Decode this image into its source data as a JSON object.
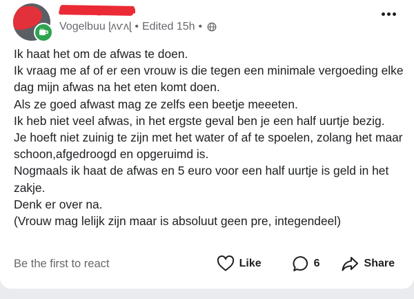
{
  "post": {
    "author_meta": "Vogelbuu ɭʌѵʌɭ • Edited 15h •",
    "author_group": "Vogelbuu ɭʌѵʌɭ",
    "edited_label": "Edited 15h",
    "lines": [
      "Ik haat het om de afwas te doen.",
      "Ik vraag me af of er een vrouw is die tegen een minimale vergoeding elke dag mijn afwas na het eten komt doen.",
      "Als ze goed afwast mag ze zelfs een beetje meeeten.",
      "Ik heb niet veel afwas, in het ergste geval ben je een half uurtje bezig.",
      "Je hoeft niet zuinig te zijn met het water of af te spoelen, zolang het maar schoon,afgedroogd en opgeruimd is.",
      "Nogmaals ik haat de afwas en 5 euro voor een half uurtje is geld in het zakje.",
      "Denk er over na.",
      "(Vrouw mag lelijk zijn maar is absoluut geen pre, integendeel)"
    ]
  },
  "footer": {
    "react_prompt": "Be the first to react",
    "like_label": "Like",
    "comment_count": "6",
    "share_label": "Share"
  },
  "icons": {
    "avatar_badge": "coffee-cup-icon",
    "visibility": "globe-icon",
    "more": "more-options-icon",
    "like": "heart-icon",
    "comment": "comment-bubble-icon",
    "share": "share-arrow-icon"
  },
  "colors": {
    "redaction": "#ea2a35",
    "badge": "#2ea44f",
    "meta_text": "#65676b"
  }
}
